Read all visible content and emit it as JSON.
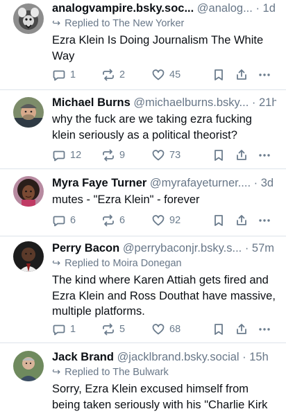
{
  "posts": [
    {
      "name": "analogvampire.bsky.soc...",
      "handle": "@analog...",
      "time": "· 1d",
      "reply_to": "Replied to The New Yorker",
      "text": "Ezra Klein Is Doing Journalism The White Way",
      "replies": "1",
      "reposts": "2",
      "likes": "45"
    },
    {
      "name": "Michael Burns",
      "handle": "@michaelburns.bsky...",
      "time": "· 21h",
      "reply_to": "",
      "text": "why the fuck are we taking ezra fucking klein seriously as a political theorist?",
      "replies": "12",
      "reposts": "9",
      "likes": "73"
    },
    {
      "name": "Myra Faye Turner",
      "handle": "@myrafayeturner....",
      "time": "· 3d",
      "reply_to": "",
      "text": "mutes - \"Ezra Klein\" - forever",
      "replies": "6",
      "reposts": "6",
      "likes": "92"
    },
    {
      "name": "Perry Bacon",
      "handle": "@perrybaconjr.bsky.s...",
      "time": "· 57m",
      "reply_to": "Replied to Moira Donegan",
      "text": "The kind where Karen Attiah gets fired and Ezra Klein and Ross Douthat have massive, multiple platforms.",
      "replies": "1",
      "reposts": "5",
      "likes": "68"
    },
    {
      "name": "Jack Brand",
      "handle": "@jacklbrand.bsky.social",
      "time": "· 15h",
      "reply_to": "Replied to The Bulwark",
      "text": "Sorry, Ezra Klein excused himself from being taken seriously with his \"Charlie Kirk",
      "replies": "",
      "reposts": "",
      "likes": ""
    }
  ],
  "colors": {
    "text": "#0b0f14",
    "muted": "#687788",
    "icon": "#6b7c8d",
    "divider": "#dde3ea"
  },
  "icons": {
    "reply": "reply-icon",
    "repost": "repost-icon",
    "like": "heart-icon",
    "bookmark": "bookmark-icon",
    "share": "share-icon",
    "more": "more-options-icon",
    "reply_arrow": "reply-arrow-icon"
  }
}
